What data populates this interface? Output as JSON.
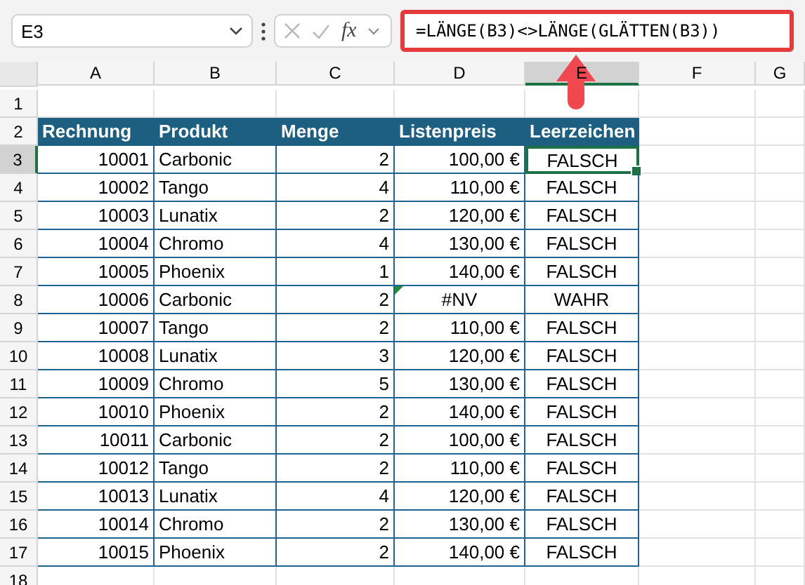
{
  "name_box": "E3",
  "function_label": "fx",
  "formula": "=LÄNGE(B3)<>LÄNGE(GLÄTTEN(B3))",
  "columns": [
    {
      "label": "A",
      "selected": false
    },
    {
      "label": "B",
      "selected": false
    },
    {
      "label": "C",
      "selected": false
    },
    {
      "label": "D",
      "selected": false
    },
    {
      "label": "E",
      "selected": true
    },
    {
      "label": "F",
      "selected": false
    },
    {
      "label": "G",
      "selected": false
    }
  ],
  "header_row": {
    "number": "2",
    "cells": [
      "Rechnung",
      "Produkt",
      "Menge",
      "Listenpreis",
      "Leerzeichen"
    ]
  },
  "first_row": "1",
  "rows": [
    {
      "number": "3",
      "cells": [
        "10001",
        "Carbonic",
        "2",
        "100,00 €",
        "FALSCH"
      ],
      "selected": true,
      "error_flag": false
    },
    {
      "number": "4",
      "cells": [
        "10002",
        "Tango",
        "4",
        "110,00 €",
        "FALSCH"
      ],
      "selected": false,
      "error_flag": false
    },
    {
      "number": "5",
      "cells": [
        "10003",
        "Lunatix",
        "2",
        "120,00 €",
        "FALSCH"
      ],
      "selected": false,
      "error_flag": false
    },
    {
      "number": "6",
      "cells": [
        "10004",
        "Chromo",
        "4",
        "130,00 €",
        "FALSCH"
      ],
      "selected": false,
      "error_flag": false
    },
    {
      "number": "7",
      "cells": [
        "10005",
        "Phoenix",
        "1",
        "140,00 €",
        "FALSCH"
      ],
      "selected": false,
      "error_flag": false
    },
    {
      "number": "8",
      "cells": [
        "10006",
        "Carbonic",
        "2",
        "#NV",
        "WAHR"
      ],
      "selected": false,
      "error_flag": true
    },
    {
      "number": "9",
      "cells": [
        "10007",
        "Tango",
        "2",
        "110,00 €",
        "FALSCH"
      ],
      "selected": false,
      "error_flag": false
    },
    {
      "number": "10",
      "cells": [
        "10008",
        "Lunatix",
        "3",
        "120,00 €",
        "FALSCH"
      ],
      "selected": false,
      "error_flag": false
    },
    {
      "number": "11",
      "cells": [
        "10009",
        "Chromo",
        "5",
        "130,00 €",
        "FALSCH"
      ],
      "selected": false,
      "error_flag": false
    },
    {
      "number": "12",
      "cells": [
        "10010",
        "Phoenix",
        "2",
        "140,00 €",
        "FALSCH"
      ],
      "selected": false,
      "error_flag": false
    },
    {
      "number": "13",
      "cells": [
        "10011",
        "Carbonic",
        "2",
        "100,00 €",
        "FALSCH"
      ],
      "selected": false,
      "error_flag": false
    },
    {
      "number": "14",
      "cells": [
        "10012",
        "Tango",
        "2",
        "110,00 €",
        "FALSCH"
      ],
      "selected": false,
      "error_flag": false
    },
    {
      "number": "15",
      "cells": [
        "10013",
        "Lunatix",
        "4",
        "120,00 €",
        "FALSCH"
      ],
      "selected": false,
      "error_flag": false
    },
    {
      "number": "16",
      "cells": [
        "10014",
        "Chromo",
        "2",
        "130,00 €",
        "FALSCH"
      ],
      "selected": false,
      "error_flag": false
    },
    {
      "number": "17",
      "cells": [
        "10015",
        "Phoenix",
        "2",
        "140,00 €",
        "FALSCH"
      ],
      "selected": false,
      "error_flag": false
    }
  ],
  "last_row": "18"
}
